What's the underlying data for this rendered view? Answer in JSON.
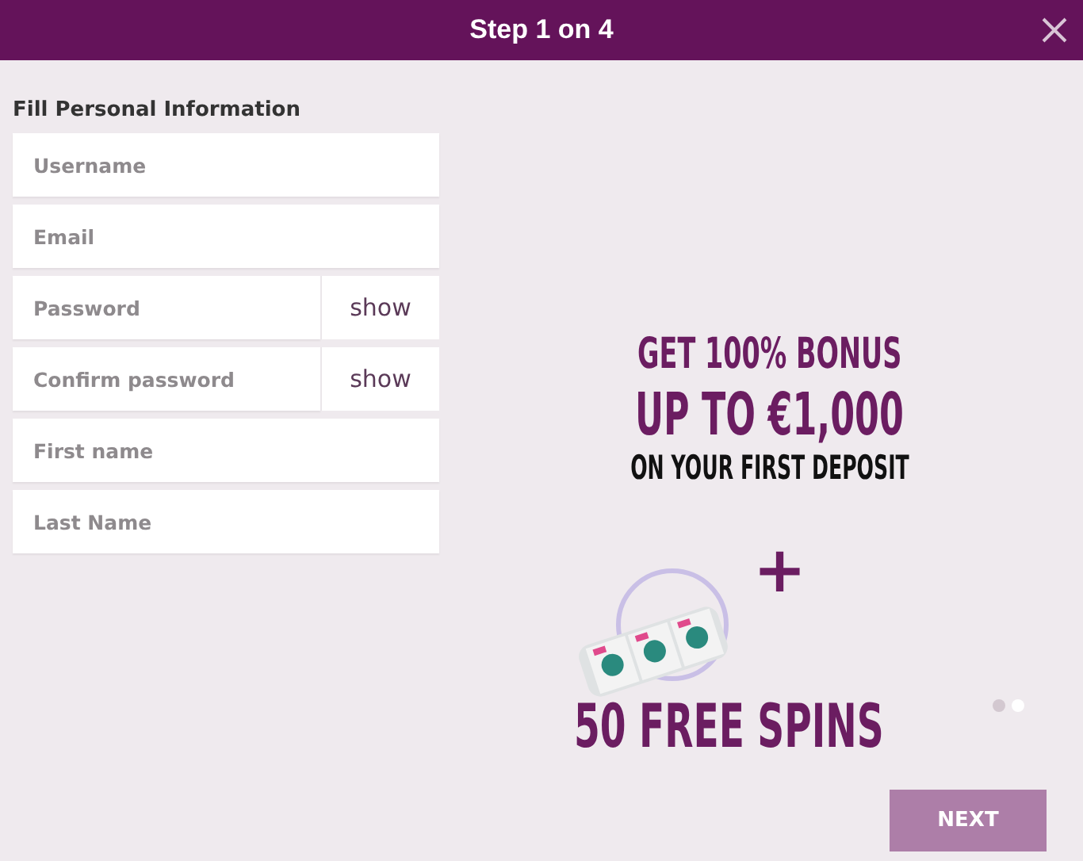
{
  "header": {
    "title": "Step 1 on 4"
  },
  "form": {
    "heading": "Fill Personal Information",
    "fields": [
      {
        "placeholder": "Username"
      },
      {
        "placeholder": "Email"
      },
      {
        "placeholder": "Password",
        "toggle": "show"
      },
      {
        "placeholder": "Confirm password",
        "toggle": "show"
      },
      {
        "placeholder": "First name"
      },
      {
        "placeholder": "Last Name"
      }
    ]
  },
  "promo": {
    "lines": [
      {
        "kind": "accent",
        "text": "GET 100% BONUS"
      },
      {
        "kind": "big",
        "text": "UP TO €1,000"
      },
      {
        "kind": "dark",
        "text": "ON YOUR FIRST DEPOSIT"
      }
    ],
    "plus": "+",
    "spins": "50 FREE SPINS",
    "dots": [
      {
        "selected": false
      },
      {
        "selected": true
      }
    ]
  },
  "next_button": "NEXT"
}
